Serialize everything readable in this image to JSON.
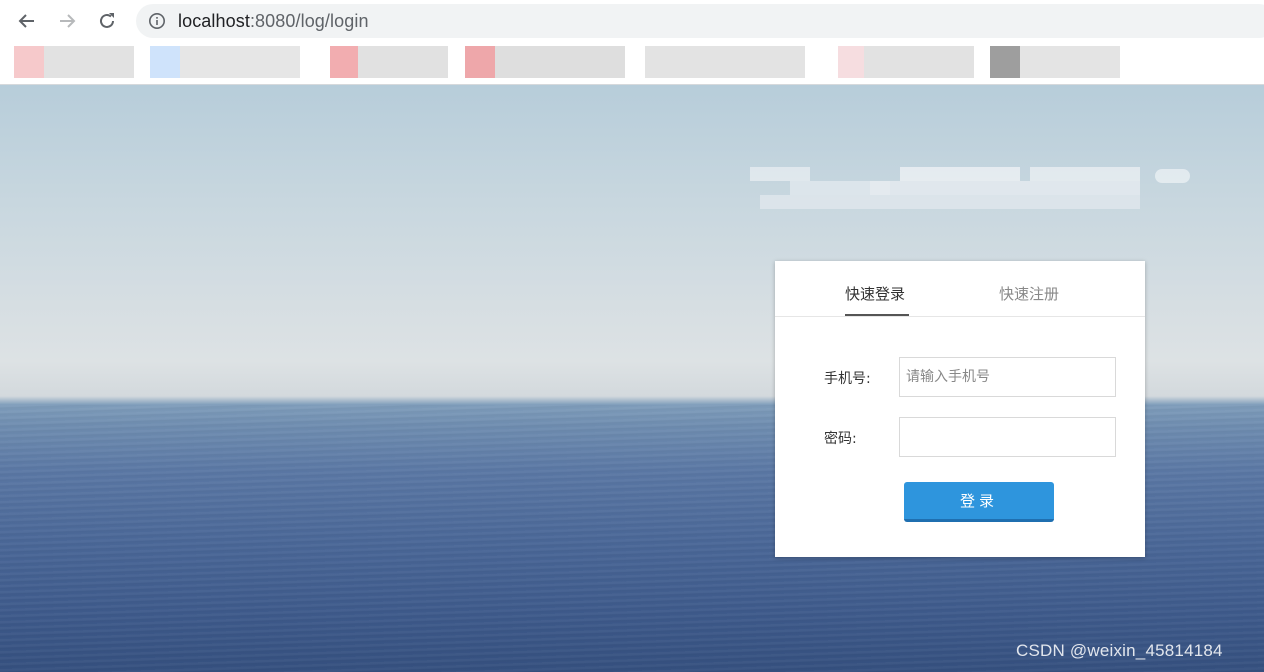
{
  "browser": {
    "url_host": "localhost",
    "url_rest": ":8080/log/login"
  },
  "login": {
    "tab_login": "快速登录",
    "tab_register": "快速注册",
    "phone_label": "手机号:",
    "phone_placeholder": "请输入手机号",
    "phone_value": "",
    "password_label": "密码:",
    "password_value": "",
    "submit_label": "登录"
  },
  "watermark": "CSDN @weixin_45814184"
}
